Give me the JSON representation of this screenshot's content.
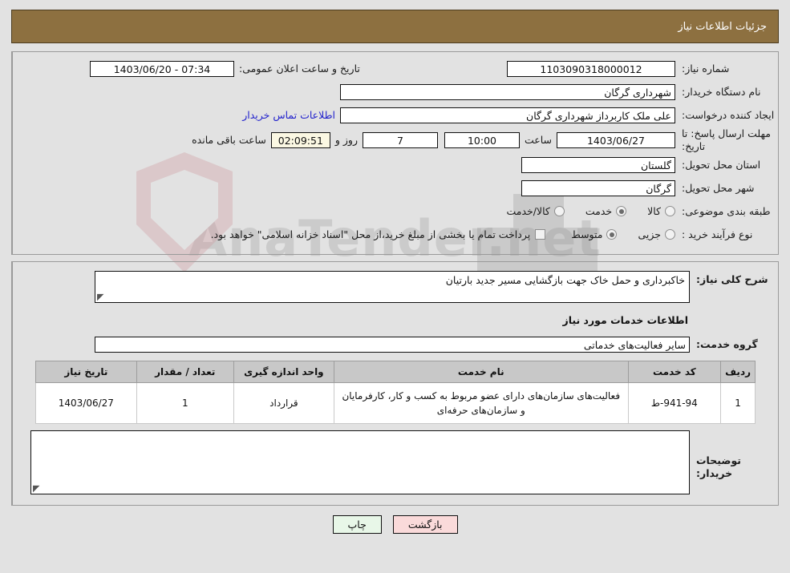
{
  "header": {
    "title": "جزئیات اطلاعات نیاز"
  },
  "form": {
    "need_number_label": "شماره نیاز:",
    "need_number_value": "1103090318000012",
    "public_announce_label": "تاریخ و ساعت اعلان عمومی:",
    "public_announce_value": "07:34 - 1403/06/20",
    "buyer_org_label": "نام دستگاه خریدار:",
    "buyer_org_value": "شهرداری گرگان",
    "creator_label": "ایجاد کننده درخواست:",
    "creator_value": "علی ملک کاربرداز شهرداری گرگان",
    "contact_link": "اطلاعات تماس خریدار",
    "deadline_label": "مهلت ارسال پاسخ: تا تاریخ:",
    "deadline_date": "1403/06/27",
    "hour_label": "ساعت",
    "deadline_time": "10:00",
    "days_value": "7",
    "days_label": "روز و",
    "timer_value": "02:09:51",
    "remaining_label": "ساعت باقی مانده",
    "province_label": "استان محل تحویل:",
    "province_value": "گلستان",
    "city_label": "شهر محل تحویل:",
    "city_value": "گرگان",
    "category_label": "طبقه بندی موضوعی:",
    "category_options": [
      {
        "label": "کالا",
        "checked": false
      },
      {
        "label": "خدمت",
        "checked": true
      },
      {
        "label": "کالا/خدمت",
        "checked": false
      }
    ],
    "process_label": "نوع فرآیند خرید :",
    "process_options": [
      {
        "label": "جزیی",
        "checked": false
      },
      {
        "label": "متوسط",
        "checked": true
      }
    ],
    "treasury_checkbox_checked": false,
    "treasury_text": "پرداخت تمام یا بخشی از مبلغ خرید،از محل \"اسناد خزانه اسلامی\" خواهد بود."
  },
  "need_desc": {
    "label": "شرح کلی نیاز:",
    "value": "خاکبرداری و حمل خاک جهت بازگشایی مسیر جدید بارتیان"
  },
  "services_section": {
    "heading": "اطلاعات خدمات مورد نیاز",
    "group_label": "گروه خدمت:",
    "group_value": "سایر فعالیت‌های خدماتی"
  },
  "table": {
    "columns": [
      "ردیف",
      "کد خدمت",
      "نام خدمت",
      "واحد اندازه گیری",
      "تعداد / مقدار",
      "تاریخ نیاز"
    ],
    "rows": [
      {
        "row": "1",
        "code": "941-94-ط",
        "name": "فعالیت‌های سازمان‌های دارای عضو مربوط به کسب و کار، کارفرمایان و سازمان‌های حرفه‌ای",
        "unit": "قرارداد",
        "qty": "1",
        "date": "1403/06/27"
      }
    ]
  },
  "buyer_notes": {
    "label": "توضیحات خریدار:",
    "value": ""
  },
  "footer": {
    "print_label": "چاپ",
    "back_label": "بازگشت"
  },
  "watermark": {
    "text": "AnaTender.net"
  },
  "colors": {
    "header_bg": "#8d7040",
    "page_bg": "#e2e2e2",
    "link": "#2222cc",
    "timer_bg": "#fbf8e3",
    "print_bg": "#e8f7e8",
    "back_bg": "#fadada",
    "table_header_bg": "#c8c8c8"
  }
}
